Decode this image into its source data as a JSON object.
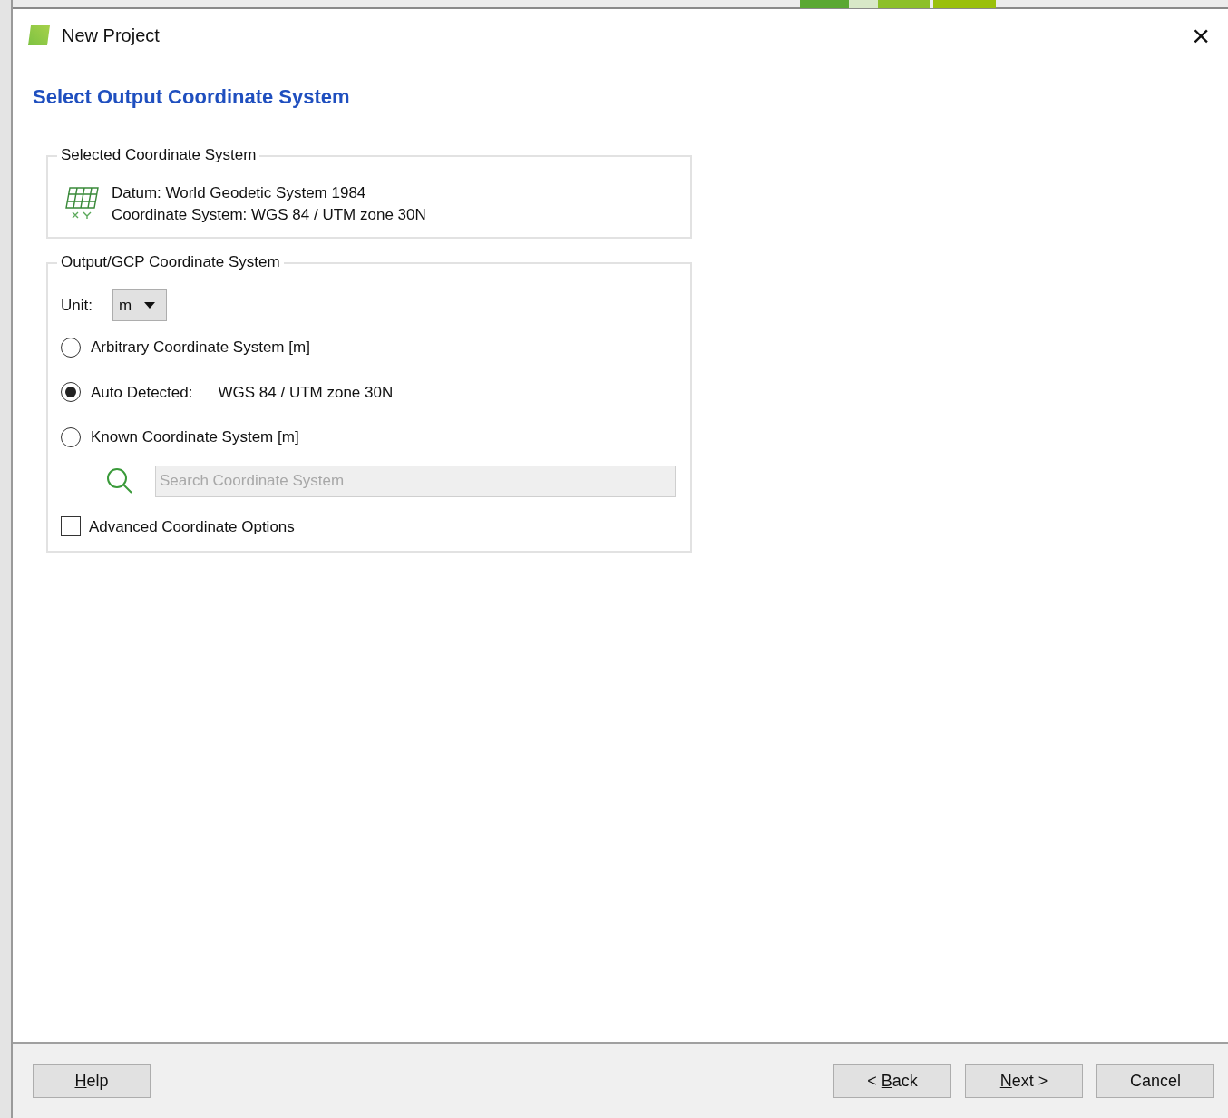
{
  "window": {
    "title": "New Project",
    "close": "×"
  },
  "heading": "Select Output Coordinate System",
  "selected_group": {
    "title": "Selected Coordinate System",
    "lines": [
      "Datum: World Geodetic System 1984",
      "Coordinate System: WGS 84 / UTM zone 30N"
    ]
  },
  "output_group": {
    "title": "Output/GCP Coordinate System",
    "unit": {
      "label": "Unit:",
      "value": "m"
    },
    "options": [
      {
        "label": "Arbitrary Coordinate System [m]",
        "selected": false
      },
      {
        "label": "Auto Detected:",
        "detail": "WGS 84 / UTM zone 30N",
        "selected": true
      },
      {
        "label": "Known Coordinate System [m]",
        "selected": false
      }
    ],
    "search": {
      "placeholder": "Search Coordinate System",
      "disabled": true
    },
    "advanced": {
      "label": "Advanced Coordinate Options",
      "checked": false
    }
  },
  "left_buttons": [
    {
      "key": "H",
      "rest": "elp"
    }
  ],
  "right_buttons": [
    {
      "prefix": "< ",
      "key": "B",
      "rest": "ack"
    },
    {
      "key": "N",
      "rest": "ext >"
    },
    {
      "rest": "Cancel"
    }
  ]
}
